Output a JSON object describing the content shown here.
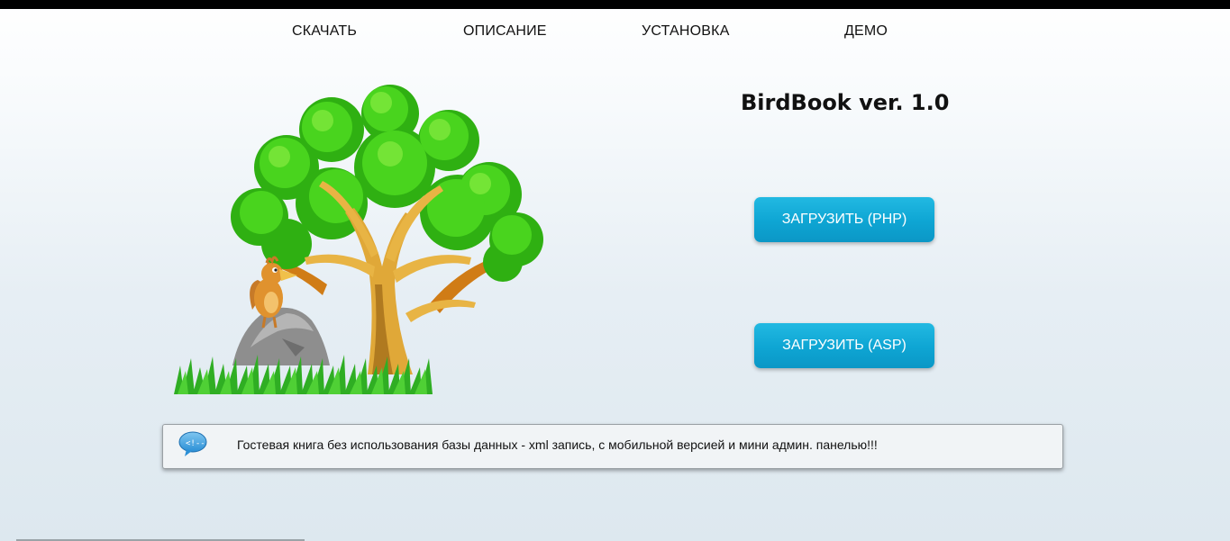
{
  "nav": {
    "items": [
      {
        "label": "СКАЧАТЬ"
      },
      {
        "label": "ОПИСАНИЕ"
      },
      {
        "label": "УСТАНОВКА"
      },
      {
        "label": "ДЕМО"
      }
    ]
  },
  "main": {
    "title": "BirdBook ver. 1.0",
    "buttons": {
      "php_label": "ЗАГРУЗИТЬ (PHP)",
      "asp_label": "ЗАГРУЗИТЬ (ASP)"
    }
  },
  "info": {
    "icon": "speech-bubble-code-icon",
    "text": "Гостевая книга без использования базы данных - xml запись, с мобильной версией и мини админ. панелью!!!"
  },
  "colors": {
    "button": "#0ea5d3",
    "top_bar": "#000000",
    "leaves": "#3fcf1a",
    "trunk": "#e0a838"
  }
}
